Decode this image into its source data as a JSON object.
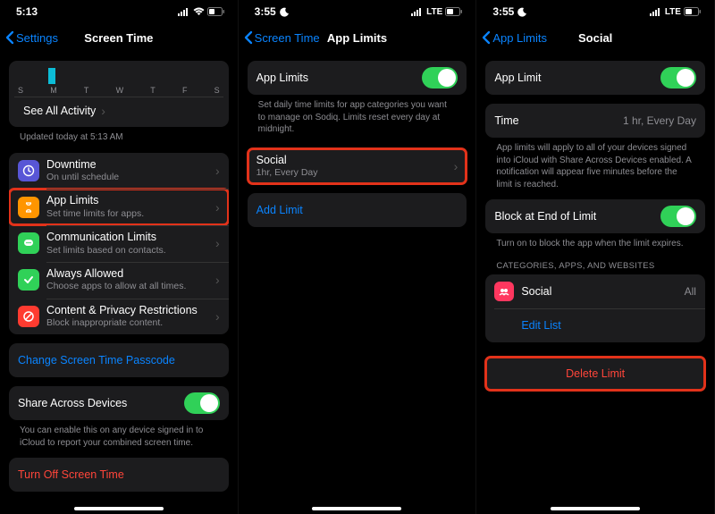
{
  "screen1": {
    "status": {
      "time": "5:13",
      "network": "",
      "lte": ""
    },
    "nav": {
      "back": "Settings",
      "title": "Screen Time"
    },
    "chart_days": [
      "S",
      "M",
      "T",
      "W",
      "T",
      "F",
      "S"
    ],
    "see_all": "See All Activity",
    "updated": "Updated today at 5:13 AM",
    "rows": {
      "downtime": {
        "label": "Downtime",
        "sub": "On until schedule"
      },
      "app_limits": {
        "label": "App Limits",
        "sub": "Set time limits for apps."
      },
      "comm": {
        "label": "Communication Limits",
        "sub": "Set limits based on contacts."
      },
      "always": {
        "label": "Always Allowed",
        "sub": "Choose apps to allow at all times."
      },
      "content": {
        "label": "Content & Privacy Restrictions",
        "sub": "Block inappropriate content."
      }
    },
    "change_passcode": "Change Screen Time Passcode",
    "share": {
      "label": "Share Across Devices"
    },
    "share_footer": "You can enable this on any device signed in to iCloud to report your combined screen time.",
    "turn_off": "Turn Off Screen Time"
  },
  "screen2": {
    "status": {
      "time": "3:55",
      "network": "LTE"
    },
    "nav": {
      "back": "Screen Time",
      "title": "App Limits"
    },
    "app_limits": {
      "label": "App Limits"
    },
    "app_limits_footer": "Set daily time limits for app categories you want to manage on Sodiq. Limits reset every day at midnight.",
    "social": {
      "label": "Social",
      "sub": "1hr, Every Day"
    },
    "add_limit": "Add Limit"
  },
  "screen3": {
    "status": {
      "time": "3:55",
      "network": "LTE"
    },
    "nav": {
      "back": "App Limits",
      "title": "Social"
    },
    "app_limit": {
      "label": "App Limit"
    },
    "time_row": {
      "label": "Time",
      "value": "1 hr, Every Day"
    },
    "time_footer": "App limits will apply to all of your devices signed into iCloud with Share Across Devices enabled. A notification will appear five minutes before the limit is reached.",
    "block": {
      "label": "Block at End of Limit"
    },
    "block_footer": "Turn on to block the app when the limit expires.",
    "cat_header": "CATEGORIES, APPS, AND WEBSITES",
    "social_row": {
      "label": "Social",
      "value": "All"
    },
    "edit_list": "Edit List",
    "delete": "Delete Limit"
  },
  "colors": {
    "purple": "#5856d6",
    "orange": "#ff9500",
    "green": "#30d158",
    "red": "#ff3b30",
    "pink": "#ff375f"
  }
}
